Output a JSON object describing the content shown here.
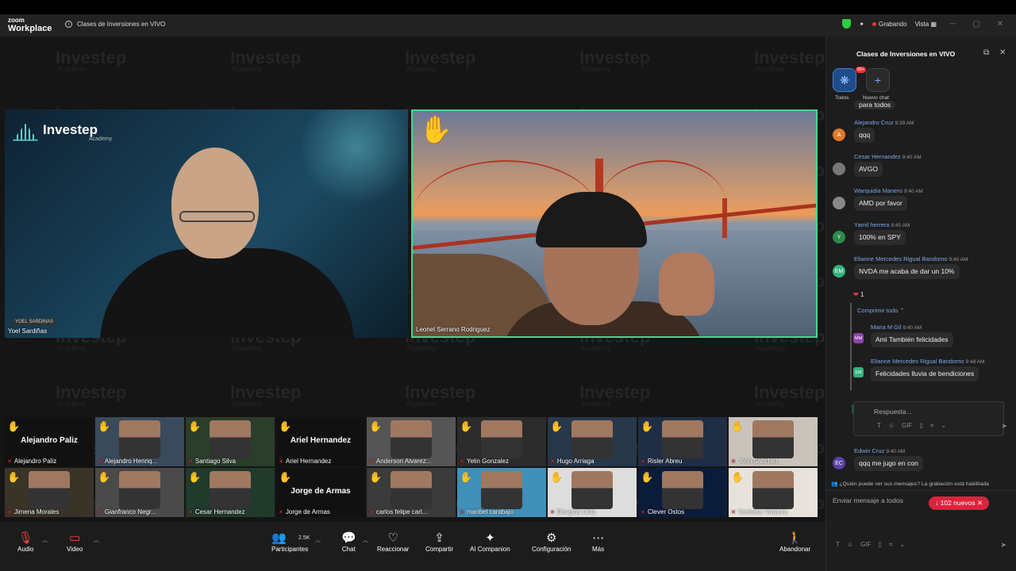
{
  "titlebar": {
    "logo_top": "zoom",
    "logo_bottom": "Workplace",
    "meeting_title": "Clases de Inversiones en VIVO",
    "recording": "Grabando",
    "view": "Vista"
  },
  "watermark": {
    "brand": "Investep",
    "sub": "Academy"
  },
  "main_left": {
    "brand": "Investep",
    "brand_sub": "Academy",
    "name_card": "YOEL SARDINAS",
    "name": "Yoel Sardiñas"
  },
  "main_right": {
    "name": "Leonel Serrano Rodriguez"
  },
  "gallery": [
    {
      "name": "Alejandro Paliz",
      "big": "Alejandro Paliz"
    },
    {
      "name": "Alejandro Henriq..."
    },
    {
      "name": "Santiago Silva"
    },
    {
      "name": "Ariel Hernandez",
      "big": "Ariel Hernandez"
    },
    {
      "name": "Anderson Alvarez..."
    },
    {
      "name": "Yelin Gonzalez"
    },
    {
      "name": "Hugo Arriaga"
    },
    {
      "name": "Risler Abreu"
    },
    {
      "name": "John Sanchez"
    },
    {
      "name": "Jimena Morales"
    },
    {
      "name": "Gianfranco Negr..."
    },
    {
      "name": "Cesar Hernandez"
    },
    {
      "name": "Jorge de Armas",
      "big": "Jorge de Armas"
    },
    {
      "name": "carlos felipe carl..."
    },
    {
      "name": "maribel carabajo"
    },
    {
      "name": "Douglas Ortiz"
    },
    {
      "name": "Clever Ostos"
    },
    {
      "name": "Veronica Villatoro"
    }
  ],
  "toolbar": {
    "audio": "Audio",
    "video": "Video",
    "participants_count": "2.5K",
    "participants": "Participantes",
    "chat": "Chat",
    "react": "Reaccionar",
    "share": "Compartir",
    "ai": "AI Companion",
    "settings": "Configuración",
    "more": "Más",
    "leave": "Abandonar"
  },
  "chat": {
    "title": "Clases de Inversiones en VIVO",
    "tab_all": "Todos",
    "tab_all_badge": "99+",
    "tab_new": "Nuevo chat",
    "partial_top": "para todos",
    "messages": [
      {
        "sender": "Alejandro Cruz",
        "time": "9:39 AM",
        "text": "qqq",
        "initials": "A",
        "color": "#e07b2a"
      },
      {
        "sender": "Cesar Hernandez",
        "time": "9:40 AM",
        "text": "AVGO",
        "initials": "",
        "color": "#777777"
      },
      {
        "sender": "Warquidia Manero",
        "time": "9:40 AM",
        "text": "AMD por favor",
        "initials": "",
        "color": "#888888"
      },
      {
        "sender": "Yamil herrera",
        "time": "9:40 AM",
        "text": "100% en SPY",
        "initials": "Y",
        "color": "#2a8a4a"
      },
      {
        "sender": "Elianne Mercedes Rigual Bandomo",
        "time": "9:40 AM",
        "text": "NVDA me acaba de dar un 10%",
        "initials": "EM",
        "color": "#36b37e"
      }
    ],
    "reaction_count": "1",
    "collapse": "Comprimir todo",
    "replies": [
      {
        "sender": "Maria M Gil",
        "time": "9:40 AM",
        "text": "Ami También felicidades",
        "initials": "MM",
        "color": "#8e44ad"
      },
      {
        "sender": "Elianne Mercedes Rigual Bandomo",
        "time": "9:48 AM",
        "text": "Felicidades lluvia de bendiciones",
        "initials": "EM",
        "color": "#36b37e"
      }
    ],
    "reply_placeholder": "Respuesta...",
    "last_sender": "Edwin Cruz",
    "last_time": "9:40 AM",
    "last_text": "qqq me jugo en con",
    "last_initials": "EC",
    "new_messages": "102 nuevos",
    "who_note": "¿Quién puede ver sus mensajes? La grabación está habilitada",
    "compose_placeholder": "Enviar mensaje a todos"
  }
}
